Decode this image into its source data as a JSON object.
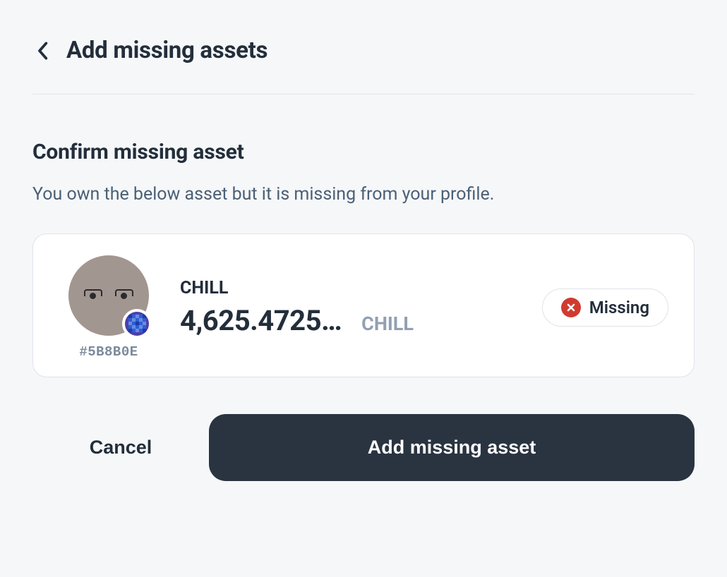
{
  "header": {
    "title": "Add missing assets"
  },
  "section": {
    "subtitle": "Confirm missing asset",
    "description": "You own the below asset but it is missing from your profile."
  },
  "asset": {
    "name": "CHILL",
    "amount": "4,625.4725…",
    "ticker": "CHILL",
    "avatar_hex": "#5B8B0E",
    "status_label": "Missing"
  },
  "actions": {
    "cancel_label": "Cancel",
    "primary_label": "Add missing asset"
  }
}
